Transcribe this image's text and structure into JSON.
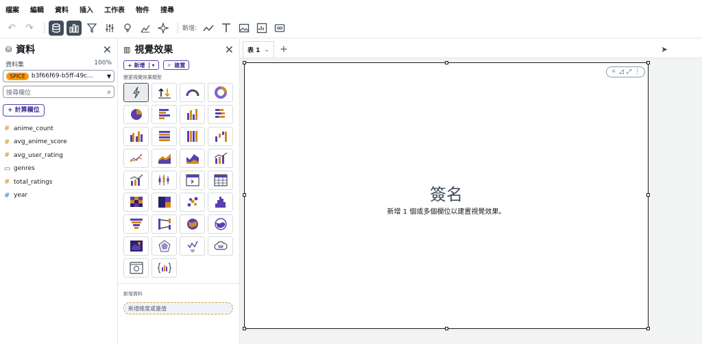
{
  "menu": [
    "檔案",
    "編輯",
    "資料",
    "插入",
    "工作表",
    "物件",
    "搜尋"
  ],
  "toolbar": {
    "add_label": "新增:"
  },
  "data_panel": {
    "title": "資料",
    "dataset_label": "資料集",
    "dataset_pct": "100%",
    "spice_badge": "SPICE",
    "dataset_name": "b3f66f69-b5ff-49c...",
    "search_placeholder": "搜尋欄位",
    "calc_button": "+ 計算欄位",
    "fields": [
      {
        "name": "anime_count",
        "type": "#"
      },
      {
        "name": "avg_anime_score",
        "type": "#"
      },
      {
        "name": "avg_user_rating",
        "type": "#"
      },
      {
        "name": "genres",
        "type": "▭"
      },
      {
        "name": "total_ratings",
        "type": "#"
      },
      {
        "name": "year",
        "type": "#"
      }
    ]
  },
  "visuals_panel": {
    "title": "視覺效果",
    "add_button": "+ 新增",
    "build_button": "建置",
    "change_type_label": "變更視覺效果類型",
    "add_data_label": "新增資料",
    "add_data_placeholder": "新增維度或量值"
  },
  "sheet": {
    "tab_label": "表 1",
    "visual_title": "簽名",
    "visual_hint": "新增 1 個或多個欄位以建置視覺效果。"
  },
  "colors": {
    "accent": "#5a3fb0",
    "spice": "#ff9900",
    "measure": "#d18a1f",
    "dimension": "#2e7bb5"
  }
}
